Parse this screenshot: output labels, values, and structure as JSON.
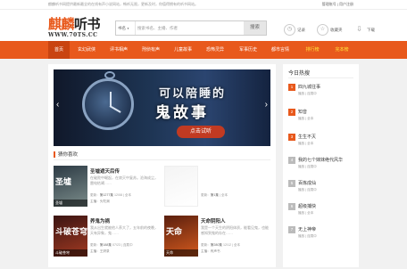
{
  "topbar": {
    "notice": "麒麟听书网提供最新最全的在线有声小说网站，畅听无限，更新及时，你值得拥有的听书网站。",
    "login": "管理账号",
    "register": "用户注册",
    "separator": "|"
  },
  "logo": {
    "name_part1": "麒麟",
    "name_part2": "听书",
    "url": "WWW.70TS.CC"
  },
  "search": {
    "category": "书名",
    "placeholder": "搜索书名、主播、作者",
    "button": "搜索"
  },
  "header_icons": [
    {
      "icon": "clock-icon",
      "glyph": "◷",
      "label": "记录"
    },
    {
      "icon": "star-icon",
      "glyph": "☆",
      "label": "收藏夹"
    },
    {
      "icon": "download-icon",
      "glyph": "⇩",
      "label": "下载"
    }
  ],
  "nav": [
    {
      "label": "首页",
      "active": true
    },
    {
      "label": "玄幻武侠"
    },
    {
      "label": "评书相声"
    },
    {
      "label": "刑侦有声"
    },
    {
      "label": "儿童故事"
    },
    {
      "label": "恐怖灵异"
    },
    {
      "label": "军事历史"
    },
    {
      "label": "都市言情"
    },
    {
      "label": "排行榜",
      "highlight": true
    },
    {
      "label": "完本榜",
      "highlight": true
    }
  ],
  "banner": {
    "line1": "可以陪睡的",
    "line2": "鬼故事",
    "cta": "点击试听",
    "slides": 5,
    "current_slide": 1
  },
  "section": {
    "title": "猜你喜欢"
  },
  "cards": [
    {
      "cover_text": "圣墟",
      "cover_footer": "圣墟",
      "title": "圣墟遮天后传",
      "desc": "在破败中崛起，在寂灭中复苏。沧海成尘，雷电枯竭……",
      "meta_label": "更新：",
      "meta_value": "第1277集",
      "meta_date": "12/08 | 全本",
      "anchor": "主播：头陀渊",
      "color1": "#2c3a44",
      "color2": "#7b8c8a"
    },
    {
      "cover_text": "",
      "cover_footer": "",
      "title": "",
      "desc": "",
      "meta_label": "更新：",
      "meta_value": "第1集",
      "meta_date": "| 全本",
      "anchor": "",
      "color1": "#f4f4f4",
      "color2": "#ffffff"
    },
    {
      "cover_text": "斗破苍穹",
      "cover_footer": "斗破苍穹",
      "title": "养鬼为祸",
      "desc": "我从出生就被他人养大了，五年前的夜晚，天有异象，鬼……",
      "meta_label": "更新：",
      "meta_value": "第188集",
      "meta_date": "07/23 | 连载中",
      "anchor": "主播：王妍录",
      "color1": "#3a1412",
      "color2": "#a23a22"
    },
    {
      "cover_text": "天命",
      "cover_footer": "天命",
      "title": "天命阴阳人",
      "desc": "我是一个天生的阴阳体质，能看见鬼，也能感知到鬼的存在……",
      "meta_label": "更新：",
      "meta_value": "第280集",
      "meta_date": "12/12 | 全本",
      "anchor": "主播：有声书",
      "color1": "#5a1f0e",
      "color2": "#d45a1e"
    }
  ],
  "sidebar": {
    "title": "今日热搜",
    "ranks": [
      {
        "num": "1",
        "title": "四九城往事",
        "meta": "播放 | 连载中"
      },
      {
        "num": "2",
        "title": "知音",
        "meta": "播放 | 全本"
      },
      {
        "num": "3",
        "title": "生生不灭",
        "meta": "播放 | 全本"
      },
      {
        "num": "4",
        "title": "我的七个妹妹绝代风华",
        "meta": "播放 | 连载中"
      },
      {
        "num": "5",
        "title": "百炼成仙",
        "meta": "播放 | 连载中"
      },
      {
        "num": "6",
        "title": "超级捕快",
        "meta": "播放 | 全本"
      },
      {
        "num": "7",
        "title": "无上神帝",
        "meta": "播放 | 连载中"
      }
    ]
  },
  "colors": {
    "brand": "#e8591c",
    "nav_active": "#c94411",
    "highlight": "#ffe53b"
  }
}
